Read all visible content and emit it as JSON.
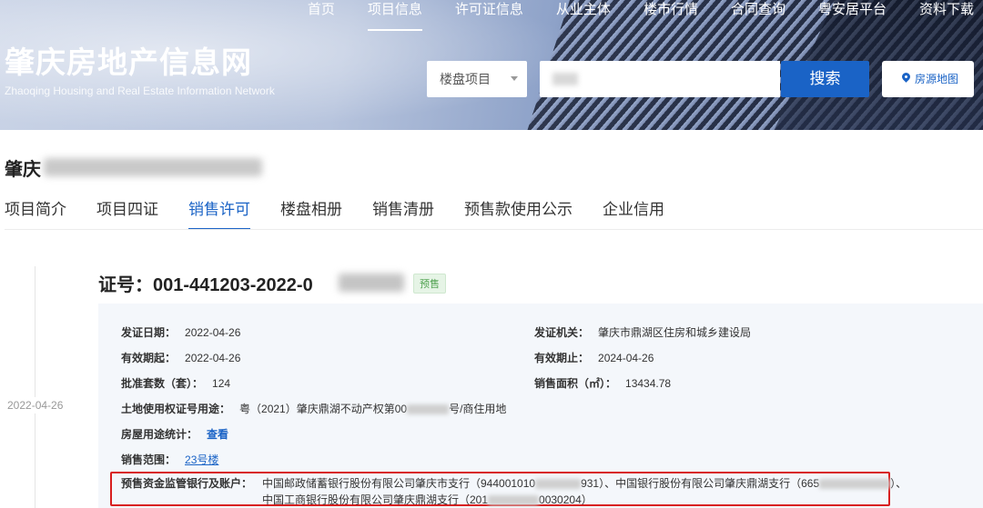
{
  "nav": [
    "首页",
    "项目信息",
    "许可证信息",
    "从业主体",
    "楼市行情",
    "合同查询",
    "粤安居平台",
    "资料下载"
  ],
  "site": {
    "title": "肇庆房地产信息网",
    "subtitle": "Zhaoqing Housing and Real Estate Information Network"
  },
  "search": {
    "select_value": "楼盘项目",
    "button": "搜索",
    "map_button": "房源地图"
  },
  "project": {
    "title_prefix": "肇庆"
  },
  "tabs": [
    "项目简介",
    "项目四证",
    "销售许可",
    "楼盘相册",
    "销售清册",
    "预售款使用公示",
    "企业信用"
  ],
  "timeline": {
    "date": "2022-04-26"
  },
  "cert": {
    "number_prefix": "证号：001-441203-2022-0",
    "badge": "预售",
    "issue_date_label": "发证日期：",
    "issue_date": "2022-04-26",
    "issuer_label": "发证机关：",
    "issuer": "肇庆市鼎湖区住房和城乡建设局",
    "valid_from_label": "有效期起：",
    "valid_from": "2022-04-26",
    "valid_to_label": "有效期止：",
    "valid_to": "2024-04-26",
    "units_label": "批准套数（套）：",
    "units": "124",
    "area_label": "销售面积（㎡）：",
    "area": "13434.78",
    "land_label": "土地使用权证号用途：",
    "land_prefix": "粤（2021）肇庆鼎湖不动产权第00",
    "land_suffix": "号/商住用地",
    "usage_label": "房屋用途统计：",
    "usage_link": "查看",
    "scope_label": "销售范围：",
    "scope_link": "23号楼",
    "bank_label": "预售资金监管银行及账户：",
    "bank_line1_a": "中国邮政储蓄银行股份有限公司肇庆市支行（944001010",
    "bank_line1_b": "931）、中国银行股份有限公司肇庆鼎湖支行（665",
    "bank_line1_c": "）、",
    "bank_line2_a": "中国工商银行股份有限公司肇庆鼎湖支行（201",
    "bank_line2_b": "0030204）"
  },
  "colors": {
    "accent": "#1a63c6",
    "highlight": "#d81e1e",
    "badge": "#52a352"
  }
}
